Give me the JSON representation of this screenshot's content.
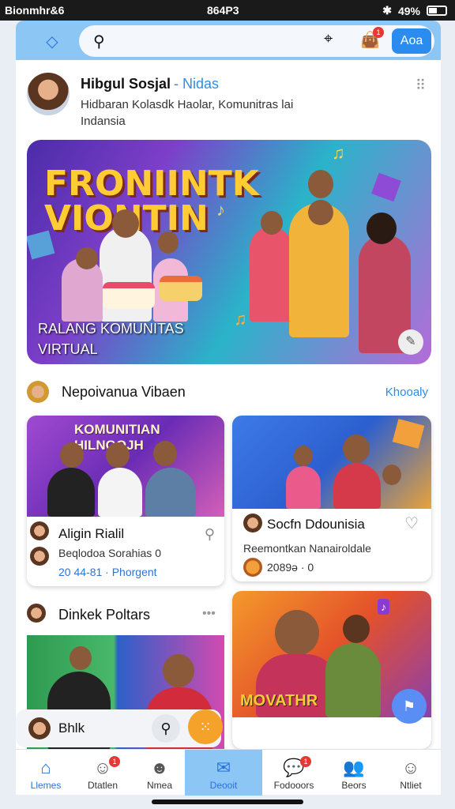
{
  "status": {
    "left": "Bionmhr&6",
    "time": "864P3",
    "battery": "49%"
  },
  "header": {
    "add_label": "Aoa",
    "badge": "1"
  },
  "profile": {
    "name": "Hibgul Sosjal",
    "tag": "- Nidas",
    "subtitle": "Hidbaran Kolasdk Haolar, Komunitras lai Indansia"
  },
  "hero": {
    "title_line1": "FRONIINTK",
    "title_line2": "VIONTIN",
    "caption_line1": "RALANG KOMUNITAS",
    "caption_line2": "VIRTUAL"
  },
  "section": {
    "title": "Nepoivanua Vibaen",
    "more": "Khooaly"
  },
  "cards": [
    {
      "banner": "KOMUNITIAN HILNGOJH",
      "title": "Aligin Rialil",
      "desc": "Beqlodoa Sorahias 0",
      "meta": "20 44-81 · Phorgent"
    },
    {
      "title": "Socfn Ddounisia",
      "desc": "Reemontkan Nanairoldale",
      "meta": "2089ə · 0"
    },
    {
      "title": "Dinkek Poltars"
    },
    {
      "banner": "MOVATHR"
    }
  ],
  "mini": {
    "label": "Bhlk"
  },
  "nav": [
    {
      "label": "Llemes",
      "icon": "home-icon"
    },
    {
      "label": "Dtatlen",
      "icon": "chat-icon",
      "badge": "1"
    },
    {
      "label": "Nmea",
      "icon": "smile-icon"
    },
    {
      "label": "Deooit",
      "icon": "message-icon"
    },
    {
      "label": "Fodooors",
      "icon": "chat-bubble-icon",
      "badge": "1"
    },
    {
      "label": "Beors",
      "icon": "people-icon"
    },
    {
      "label": "Ntliet",
      "icon": "face-icon"
    }
  ]
}
